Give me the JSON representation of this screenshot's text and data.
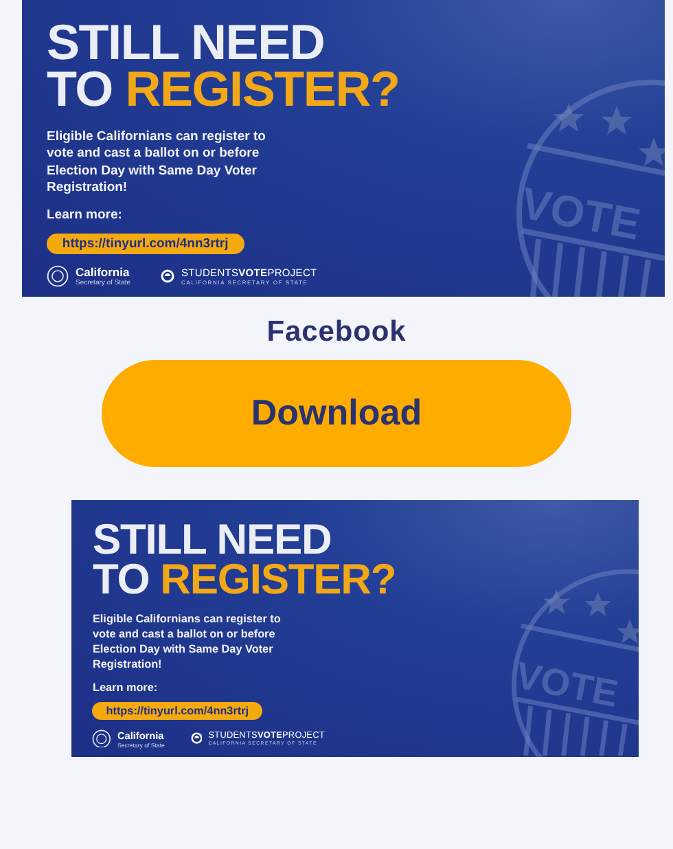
{
  "graphics": [
    {
      "headline_top": "STILL NEED",
      "headline_lead": "TO",
      "headline_highlight": "REGISTER?",
      "body": "Eligible Californians can register to vote and cast a ballot on or before Election Day with Same Day Voter Registration!",
      "learn_more": "Learn more:",
      "link": "https://tinyurl.com/4nn3rtrj",
      "badge_text": "VOTE",
      "sos_name": "California",
      "sos_sub": "Secretary of State",
      "project_name": "STUDENTS**VOTE**PROJECT",
      "project_sub": "CALIFORNIA SECRETARY OF STATE"
    },
    {
      "headline_top": "STILL NEED",
      "headline_lead": "TO",
      "headline_highlight": "REGISTER?",
      "body": "Eligible Californians can register to vote and cast a ballot on or before Election Day with Same Day Voter Registration!",
      "learn_more": "Learn more:",
      "link": "https://tinyurl.com/4nn3rtrj",
      "badge_text": "VOTE",
      "sos_name": "California",
      "sos_sub": "Secretary of State",
      "project_name": "STUDENTS**VOTE**PROJECT",
      "project_sub": "CALIFORNIA SECRETARY OF STATE"
    }
  ],
  "section_title": "Facebook",
  "download_button": "Download"
}
